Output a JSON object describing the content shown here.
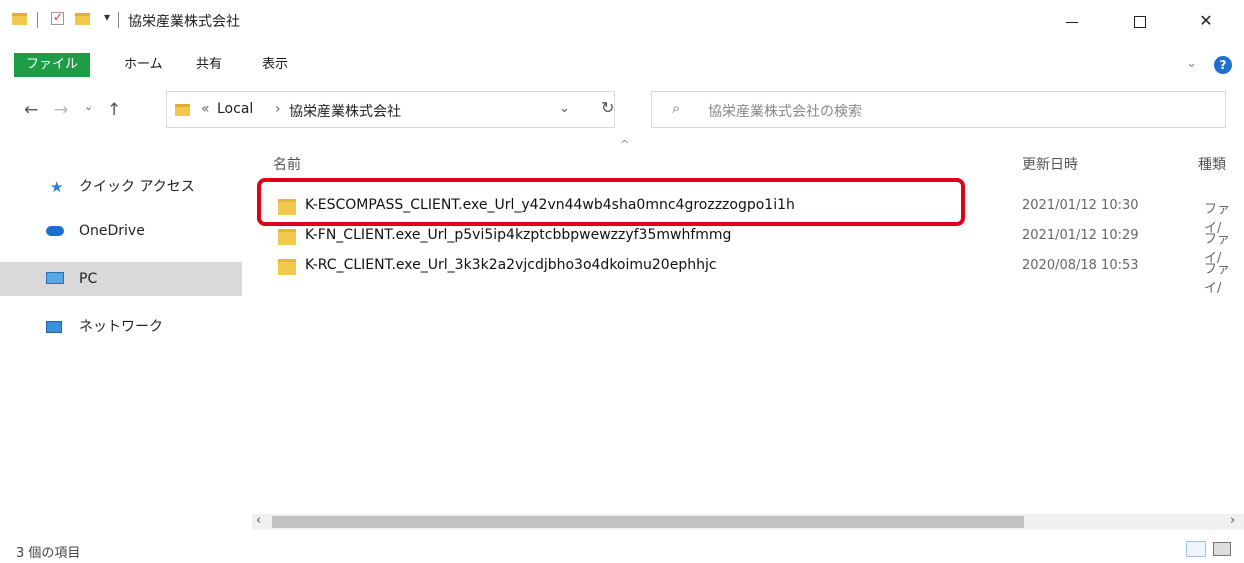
{
  "window": {
    "title": "協栄産業株式会社",
    "minimize_glyph": "—",
    "maximize_glyph": "☐",
    "close_glyph": "✕"
  },
  "ribbon": {
    "tabs": [
      {
        "label": "ファイル",
        "active": true
      },
      {
        "label": "ホーム"
      },
      {
        "label": "共有"
      },
      {
        "label": "表示"
      }
    ],
    "expand_glyph": "⌄",
    "help_glyph": "?"
  },
  "address": {
    "overflow": "«",
    "crumbs": [
      "Local",
      "協栄産業株式会社"
    ],
    "separator": "›",
    "search_placeholder": "協栄産業株式会社の検索"
  },
  "nav": {
    "items": [
      {
        "label": "クイック アクセス",
        "icon": "star-icon"
      },
      {
        "label": "OneDrive",
        "icon": "cloud-icon"
      },
      {
        "label": "PC",
        "icon": "monitor-icon",
        "selected": true
      },
      {
        "label": "ネットワーク",
        "icon": "network-icon"
      }
    ]
  },
  "files": {
    "columns": {
      "name": "名前",
      "date": "更新日時",
      "type": "種類"
    },
    "rows": [
      {
        "name": "K-ESCOMPASS_CLIENT.exe_Url_y42vn44wb4sha0mnc4grozzzogpo1i1h",
        "date": "2021/01/12 10:30",
        "type": "ファイ/"
      },
      {
        "name": "K-FN_CLIENT.exe_Url_p5vi5ip4kzptcbbpwewzzyf35mwhfmmg",
        "date": "2021/01/12 10:29",
        "type": "ファイ/"
      },
      {
        "name": "K-RC_CLIENT.exe_Url_3k3k2a2vjcdjbho3o4dkoimu20ephhjc",
        "date": "2020/08/18 10:53",
        "type": "ファイ/"
      }
    ]
  },
  "status": {
    "item_count": "3 個の項目"
  },
  "colors": {
    "file_tab": "#1e9d46",
    "highlight": "#e0001b",
    "folder": "#f2c94c",
    "nav_selected": "#d9d9d9"
  }
}
